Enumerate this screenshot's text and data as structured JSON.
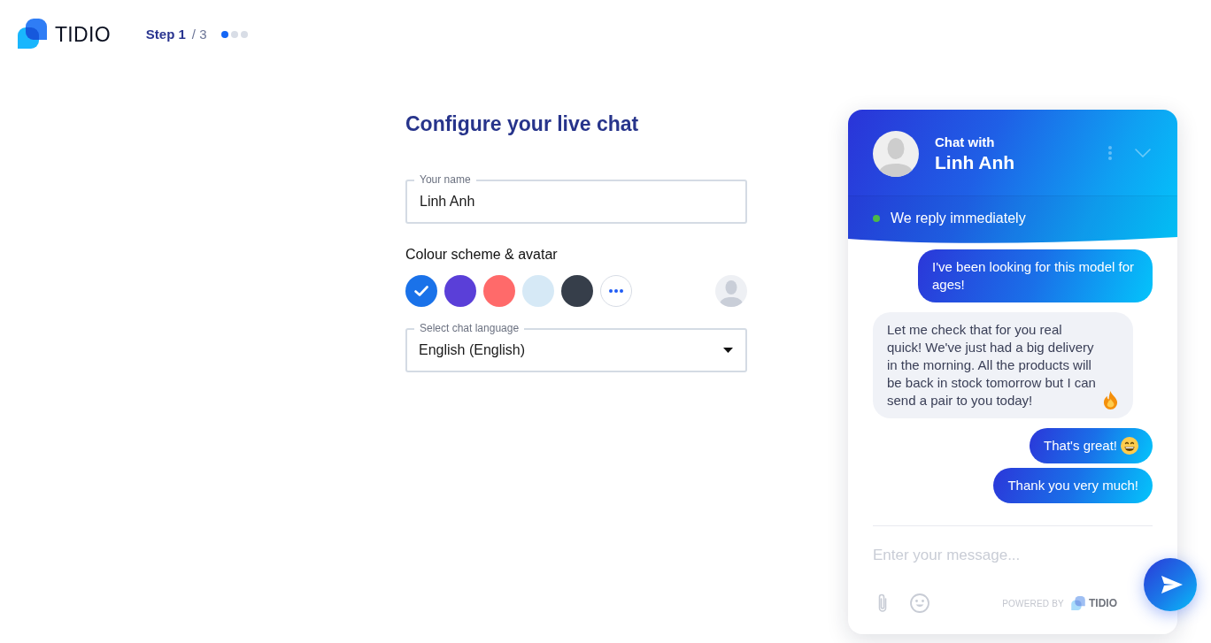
{
  "header": {
    "brand": "TIDIO",
    "stepper": {
      "current": "Step 1",
      "total": "/ 3",
      "dots": [
        {
          "selected": true
        },
        {
          "selected": false
        },
        {
          "selected": false
        }
      ]
    }
  },
  "form": {
    "title": "Configure your live chat",
    "name_field": {
      "label": "Your name",
      "value": "Linh Anh"
    },
    "colour_section": {
      "label": "Colour scheme & avatar",
      "swatches": [
        {
          "color": "#1a72e9",
          "selected": true
        },
        {
          "color": "#5a3fd8",
          "selected": false
        },
        {
          "color": "#ff6a6a",
          "selected": false
        },
        {
          "color": "#d6e9f6",
          "selected": false
        },
        {
          "color": "#363e4a",
          "selected": false
        }
      ]
    },
    "language_field": {
      "label": "Select chat language",
      "value": "English (English)"
    }
  },
  "chat_preview": {
    "title": "Chat with",
    "agent_name": "Linh Anh",
    "status": {
      "text": "We reply immediately",
      "online": true
    },
    "messages": [
      {
        "kind": "visitor",
        "text": "I've been looking for this model for ages!"
      },
      {
        "kind": "agent",
        "text": "Let me check that for you real quick! We've just had a big delivery in the morning. All the products will be back in stock tomorrow but I can send a pair to you today!",
        "emoji": {
          "kind": "fire"
        }
      },
      {
        "kind": "visitor",
        "text": "That's great!",
        "emoji": {
          "kind": "grin"
        }
      },
      {
        "kind": "visitor",
        "text": "Thank you very much!"
      }
    ],
    "composer": {
      "placeholder": "Enter your message..."
    },
    "powered_by": {
      "label": "POWERED BY",
      "brand": "TIDIO"
    }
  }
}
